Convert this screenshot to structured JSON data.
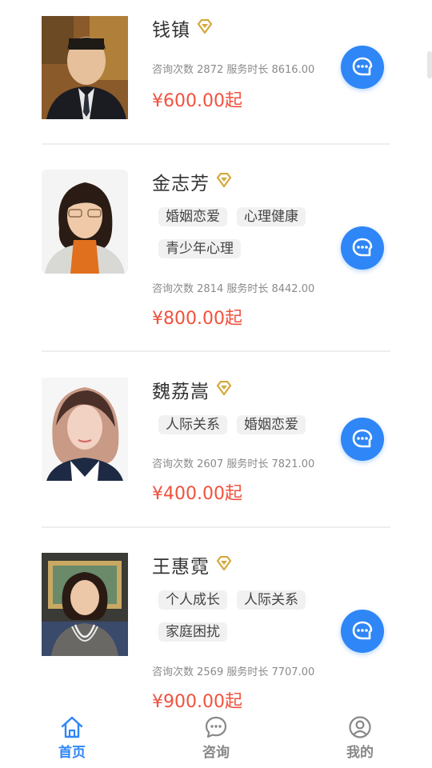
{
  "counselors": [
    {
      "name": "钱镇",
      "tags": [],
      "stats": "咨询次数 2872 服务时长 8616.00",
      "price": "¥600.00起"
    },
    {
      "name": "金志芳",
      "tags": [
        "婚姻恋爱",
        "心理健康",
        "青少年心理"
      ],
      "stats": "咨询次数 2814 服务时长 8442.00",
      "price": "¥800.00起"
    },
    {
      "name": "魏荔嵩",
      "tags": [
        "人际关系",
        "婚姻恋爱"
      ],
      "stats": "咨询次数 2607 服务时长 7821.00",
      "price": "¥400.00起"
    },
    {
      "name": "王惠霓",
      "tags": [
        "个人成长",
        "人际关系",
        "家庭困扰"
      ],
      "stats": "咨询次数 2569 服务时长 7707.00",
      "price": "¥900.00起"
    }
  ],
  "tabbar": {
    "home": "首页",
    "consult": "咨询",
    "mine": "我的"
  },
  "colors": {
    "accent": "#2f86f6",
    "price": "#f0523d",
    "badge": "#d4a83a",
    "tab_active": "#2f86f6",
    "tab_inactive": "#888888"
  }
}
